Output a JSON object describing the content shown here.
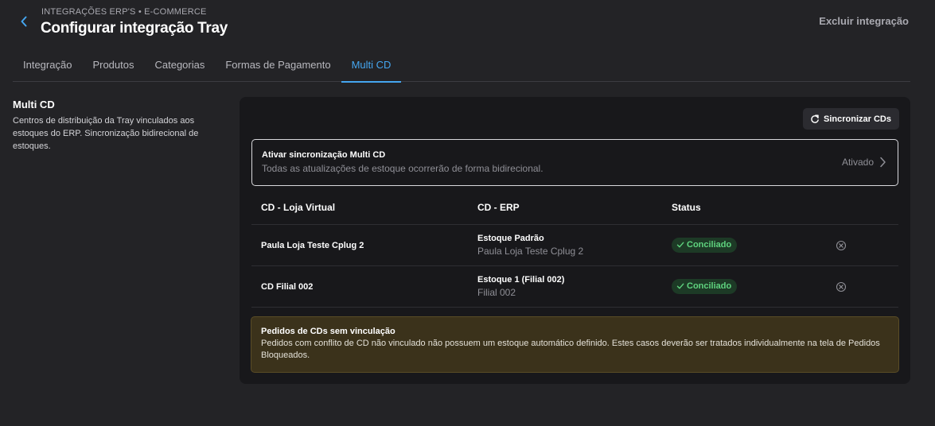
{
  "header": {
    "breadcrumb": "INTEGRAÇÕES ERP'S • E-COMMERCE",
    "title": "Configurar integração Tray",
    "delete_label": "Excluir integração",
    "back_icon": "chevron-left-icon",
    "accent_color": "#45a6f0"
  },
  "tabs": [
    {
      "label": "Integração",
      "active": false
    },
    {
      "label": "Produtos",
      "active": false
    },
    {
      "label": "Categorias",
      "active": false
    },
    {
      "label": "Formas de Pagamento",
      "active": false
    },
    {
      "label": "Multi CD",
      "active": true
    }
  ],
  "section": {
    "title": "Multi CD",
    "description": "Centros de distribuição da Tray vinculados aos estoques do ERP. Sincronização bidirecional de estoques."
  },
  "panel": {
    "sync_button_label": "Sincronizar CDs",
    "sync_icon": "refresh-icon",
    "toggle": {
      "title": "Ativar sincronização Multi CD",
      "description": "Todas as atualizações de estoque ocorrerão de forma bidirecional.",
      "status": "Ativado"
    },
    "table": {
      "headers": [
        "CD - Loja Virtual",
        "CD - ERP",
        "Status"
      ],
      "rows": [
        {
          "store_cd": "Paula Loja Teste Cplug 2",
          "erp_stock": "Estoque Padrão",
          "erp_branch": "Paula Loja Teste Cplug 2",
          "status": "Conciliado"
        },
        {
          "store_cd": "CD Filial 002",
          "erp_stock": "Estoque 1 (Filial 002)",
          "erp_branch": "Filial 002",
          "status": "Conciliado"
        }
      ]
    },
    "warning": {
      "title": "Pedidos de CDs sem vinculação",
      "text": "Pedidos com conflito de CD não vinculado não possuem um estoque automático definido. Estes casos deverão ser tratados individualmente na tela de Pedidos Bloqueados."
    }
  }
}
